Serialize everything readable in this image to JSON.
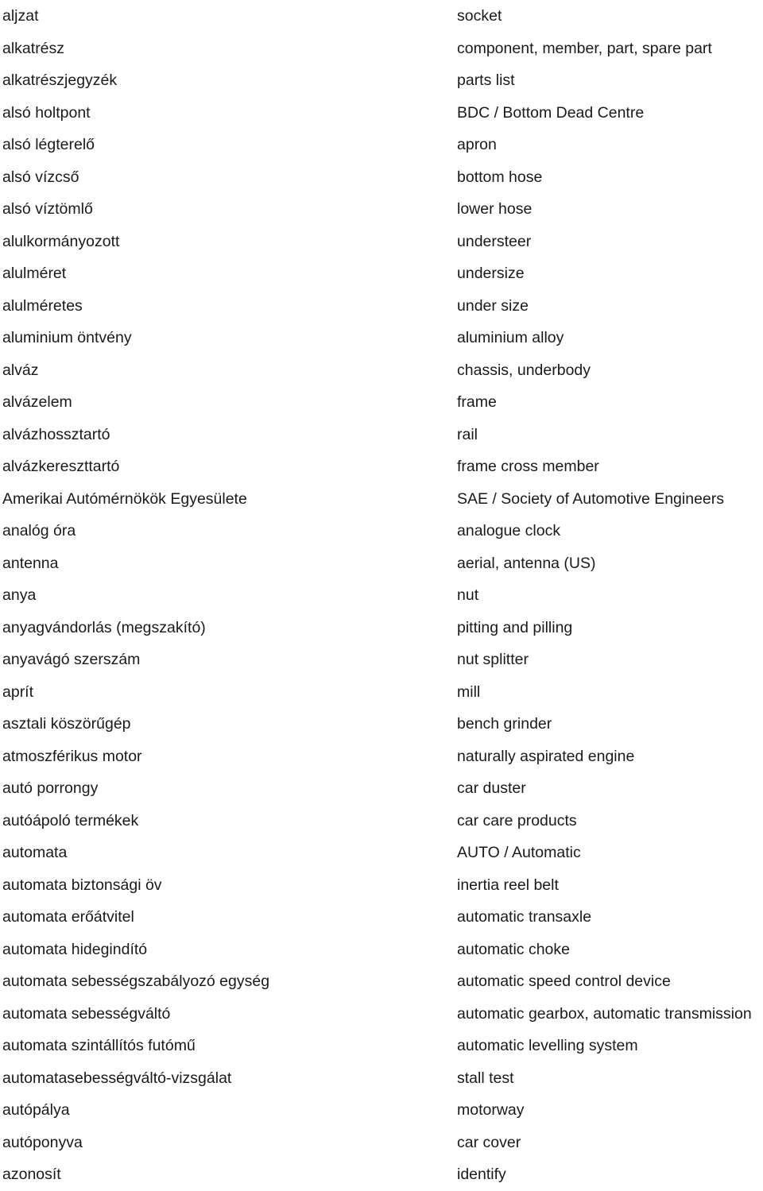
{
  "document": {
    "kind": "bilingual-glossary",
    "source_language": "Hungarian",
    "target_language": "English",
    "text_color": "#1a1a1a",
    "background_color": "#ffffff",
    "row_count": 36
  },
  "entries": [
    {
      "term": "aljzat",
      "translation": "socket"
    },
    {
      "term": "alkatrész",
      "translation": "component, member, part, spare part"
    },
    {
      "term": "alkatrészjegyzék",
      "translation": "parts list"
    },
    {
      "term": "alsó holtpont",
      "translation": "BDC / Bottom Dead Centre"
    },
    {
      "term": "alsó légterelő",
      "translation": "apron"
    },
    {
      "term": "alsó vízcső",
      "translation": "bottom hose"
    },
    {
      "term": "alsó víztömlő",
      "translation": "lower hose"
    },
    {
      "term": "alulkormányozott",
      "translation": "understeer"
    },
    {
      "term": "alulméret",
      "translation": "undersize"
    },
    {
      "term": "alulméretes",
      "translation": "under size"
    },
    {
      "term": "aluminium öntvény",
      "translation": "aluminium alloy"
    },
    {
      "term": "alváz",
      "translation": "chassis, underbody"
    },
    {
      "term": "alvázelem",
      "translation": "frame"
    },
    {
      "term": "alvázhossztartó",
      "translation": "rail"
    },
    {
      "term": "alvázkereszttartó",
      "translation": "frame cross member"
    },
    {
      "term": "Amerikai Autómérnökök Egyesülete",
      "translation": "SAE / Society of Automotive Engineers"
    },
    {
      "term": "analóg óra",
      "translation": "analogue clock"
    },
    {
      "term": "antenna",
      "translation": "aerial, antenna (US)"
    },
    {
      "term": "anya",
      "translation": "nut"
    },
    {
      "term": "anyagvándorlás (megszakító)",
      "translation": "pitting and pilling"
    },
    {
      "term": "anyavágó szerszám",
      "translation": "nut splitter"
    },
    {
      "term": "aprít",
      "translation": "mill"
    },
    {
      "term": "asztali köszörűgép",
      "translation": "bench grinder"
    },
    {
      "term": "atmoszférikus motor",
      "translation": "naturally aspirated engine"
    },
    {
      "term": "autó porrongy",
      "translation": "car duster"
    },
    {
      "term": "autóápoló termékek",
      "translation": "car care products"
    },
    {
      "term": "automata",
      "translation": "AUTO / Automatic"
    },
    {
      "term": "automata biztonsági öv",
      "translation": "inertia reel belt"
    },
    {
      "term": "automata erőátvitel",
      "translation": "automatic transaxle"
    },
    {
      "term": "automata hidegindító",
      "translation": "automatic choke"
    },
    {
      "term": "automata sebességszabályozó egység",
      "translation": "automatic speed control device"
    },
    {
      "term": "automata sebességváltó",
      "translation": "automatic gearbox, automatic transmission"
    },
    {
      "term": "automata szintállítós futómű",
      "translation": "automatic levelling system"
    },
    {
      "term": "automatasebességváltó-vizsgálat",
      "translation": "stall test"
    },
    {
      "term": "autópálya",
      "translation": "motorway"
    },
    {
      "term": "autóponyva",
      "translation": "car cover"
    },
    {
      "term": "azonosít",
      "translation": "identify"
    }
  ]
}
